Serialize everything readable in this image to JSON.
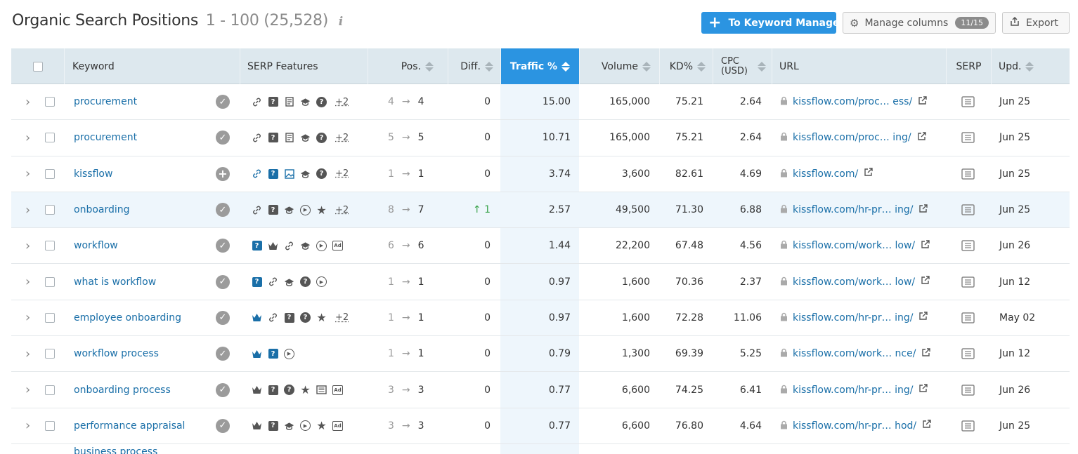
{
  "header": {
    "title": "Organic Search Positions",
    "range": "1 - 100 (25,528)",
    "info_icon": "i",
    "keyword_manager_label": "To Keyword Manager",
    "manage_columns_label": "Manage columns",
    "columns_badge": "11/15",
    "export_label": "Export"
  },
  "colors": {
    "accent": "#2b94e1",
    "link": "#1a6fa8",
    "header_bg": "#dde8ee",
    "positive": "#3aa34a"
  },
  "columns": {
    "keyword": "Keyword",
    "serp_features": "SERP Features",
    "pos": "Pos.",
    "diff": "Diff.",
    "traffic": "Traffic %",
    "volume": "Volume",
    "kd": "KD%",
    "cpc_1": "CPC",
    "cpc_2": "(USD)",
    "url": "URL",
    "serp": "SERP",
    "upd": "Upd."
  },
  "rows": [
    {
      "keyword": "procurement",
      "kw_icon": "check",
      "features": [
        "link",
        "qa",
        "article",
        "edu",
        "question"
      ],
      "more": "+2",
      "pos_from": "4",
      "pos_to": "4",
      "diff": "0",
      "traffic": "15.00",
      "volume": "165,000",
      "kd": "75.21",
      "cpc": "2.64",
      "url": "kissflow.com/proc… ess/",
      "upd": "Jun 25"
    },
    {
      "keyword": "procurement",
      "kw_icon": "check",
      "features": [
        "link",
        "qa",
        "article",
        "edu",
        "question"
      ],
      "more": "+2",
      "pos_from": "5",
      "pos_to": "5",
      "diff": "0",
      "traffic": "10.71",
      "volume": "165,000",
      "kd": "75.21",
      "cpc": "2.64",
      "url": "kissflow.com/proc… ing/",
      "upd": "Jun 25"
    },
    {
      "keyword": "kissflow",
      "kw_icon": "plus",
      "features": [
        "link-b",
        "qa-b",
        "image-b",
        "edu",
        "question"
      ],
      "more": "+2",
      "pos_from": "1",
      "pos_to": "1",
      "diff": "0",
      "traffic": "3.74",
      "volume": "3,600",
      "kd": "82.61",
      "cpc": "4.69",
      "url": "kissflow.com/",
      "upd": "Jun 25"
    },
    {
      "keyword": "onboarding",
      "kw_icon": "check",
      "features": [
        "link",
        "qa",
        "edu",
        "video",
        "star"
      ],
      "more": "+2",
      "pos_from": "8",
      "pos_to": "7",
      "diff": "↑ 1",
      "diff_up": true,
      "traffic": "2.57",
      "volume": "49,500",
      "kd": "71.30",
      "cpc": "6.88",
      "url": "kissflow.com/hr-pr… ing/",
      "upd": "Jun 25"
    },
    {
      "keyword": "workflow",
      "kw_icon": "check",
      "features": [
        "qa-b",
        "crown",
        "link",
        "edu",
        "video",
        "ad"
      ],
      "more": "",
      "pos_from": "6",
      "pos_to": "6",
      "diff": "0",
      "traffic": "1.44",
      "volume": "22,200",
      "kd": "67.48",
      "cpc": "4.56",
      "url": "kissflow.com/work… low/",
      "upd": "Jun 26"
    },
    {
      "keyword": "what is workflow",
      "kw_icon": "check",
      "features": [
        "qa-b",
        "link",
        "edu",
        "question",
        "video"
      ],
      "more": "",
      "pos_from": "1",
      "pos_to": "1",
      "diff": "0",
      "traffic": "0.97",
      "volume": "1,600",
      "kd": "70.36",
      "cpc": "2.37",
      "url": "kissflow.com/work… low/",
      "upd": "Jun 12"
    },
    {
      "keyword": "employee onboarding",
      "kw_icon": "check",
      "features": [
        "crown-b",
        "link",
        "qa",
        "question",
        "star"
      ],
      "more": "+2",
      "pos_from": "1",
      "pos_to": "1",
      "diff": "0",
      "traffic": "0.97",
      "volume": "1,600",
      "kd": "72.28",
      "cpc": "11.06",
      "url": "kissflow.com/hr-pr… ing/",
      "upd": "May 02"
    },
    {
      "keyword": "workflow process",
      "kw_icon": "check",
      "features": [
        "crown-b",
        "qa-b",
        "video"
      ],
      "more": "",
      "pos_from": "1",
      "pos_to": "1",
      "diff": "0",
      "traffic": "0.79",
      "volume": "1,300",
      "kd": "69.39",
      "cpc": "5.25",
      "url": "kissflow.com/work… nce/",
      "upd": "Jun 12"
    },
    {
      "keyword": "onboarding process",
      "kw_icon": "check",
      "features": [
        "crown",
        "qa",
        "question",
        "star",
        "news",
        "ad"
      ],
      "more": "",
      "pos_from": "3",
      "pos_to": "3",
      "diff": "0",
      "traffic": "0.77",
      "volume": "6,600",
      "kd": "74.25",
      "cpc": "6.41",
      "url": "kissflow.com/hr-pr… ing/",
      "upd": "Jun 26"
    },
    {
      "keyword": "performance appraisal",
      "kw_icon": "check",
      "features": [
        "crown",
        "qa",
        "edu",
        "video",
        "star",
        "ad"
      ],
      "more": "",
      "pos_from": "3",
      "pos_to": "3",
      "diff": "0",
      "traffic": "0.77",
      "volume": "6,600",
      "kd": "76.80",
      "cpc": "4.64",
      "url": "kissflow.com/hr-pr… hod/",
      "upd": "Jun 25"
    }
  ],
  "partial_row": {
    "keyword": "business process"
  }
}
